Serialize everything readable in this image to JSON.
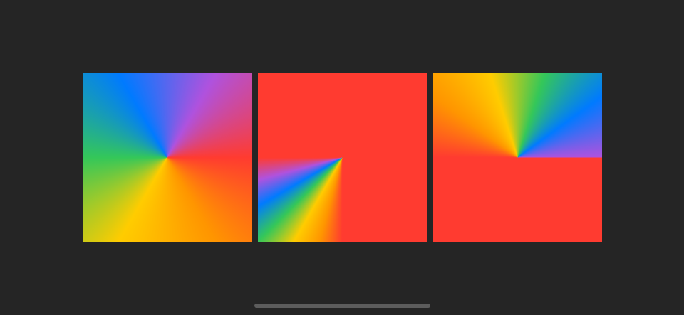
{
  "colors": {
    "background": "#252525",
    "red": "#ff3b30",
    "orange": "#ff9500",
    "yellow": "#ffcc00",
    "green": "#34c759",
    "blue": "#007aff",
    "purple": "#af52de",
    "home_indicator": "#5c5c5c"
  },
  "swatches": [
    {
      "name": "angular-gradient-full",
      "gradient_type": "angular",
      "start_angle_deg": 0,
      "end_angle_deg": 360,
      "stops": [
        "red",
        "orange",
        "yellow",
        "green",
        "blue",
        "purple",
        "red"
      ]
    },
    {
      "name": "angular-gradient-partial",
      "gradient_type": "angular",
      "start_angle_deg": 90,
      "end_angle_deg": 180,
      "stops": [
        "red",
        "orange",
        "yellow",
        "green",
        "blue",
        "purple",
        "red"
      ]
    },
    {
      "name": "angular-gradient-reversed-partial",
      "gradient_type": "angular",
      "start_angle_deg": 180,
      "end_angle_deg": 360,
      "stops": [
        "red",
        "orange",
        "yellow",
        "green",
        "blue",
        "purple"
      ]
    }
  ]
}
